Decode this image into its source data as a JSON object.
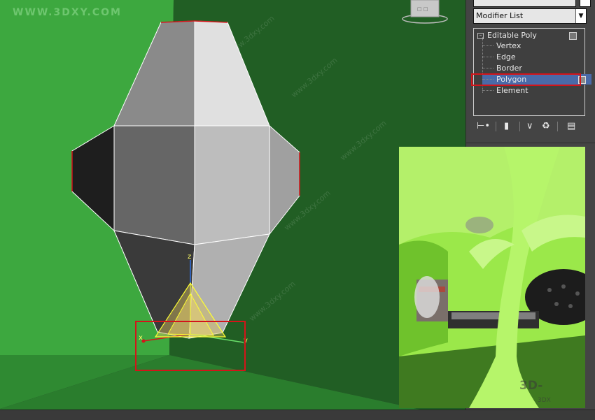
{
  "app": {
    "watermark": "WWW.3DXY.COM"
  },
  "viewport": {
    "axis_labels": {
      "x": "x",
      "y": "y",
      "z": "z"
    },
    "colors": {
      "light_green": "#3da83f",
      "dark_green": "#215e24",
      "selection_red": "#d4141a",
      "gizmo_yellow": "#ffff33"
    }
  },
  "command_panel": {
    "modifier_list_label": "Modifier List",
    "stack": {
      "root": "Editable Poly",
      "subobjects": [
        "Vertex",
        "Edge",
        "Border",
        "Polygon",
        "Element"
      ],
      "selected": "Polygon"
    },
    "toolbar_icons": [
      "pin-stack-icon",
      "show-end-result-icon",
      "make-unique-icon",
      "remove-modifier-icon",
      "configure-modifier-sets-icon"
    ]
  },
  "reference_photo": {
    "logo_text": "3D-",
    "logo_sub": "3DX"
  }
}
